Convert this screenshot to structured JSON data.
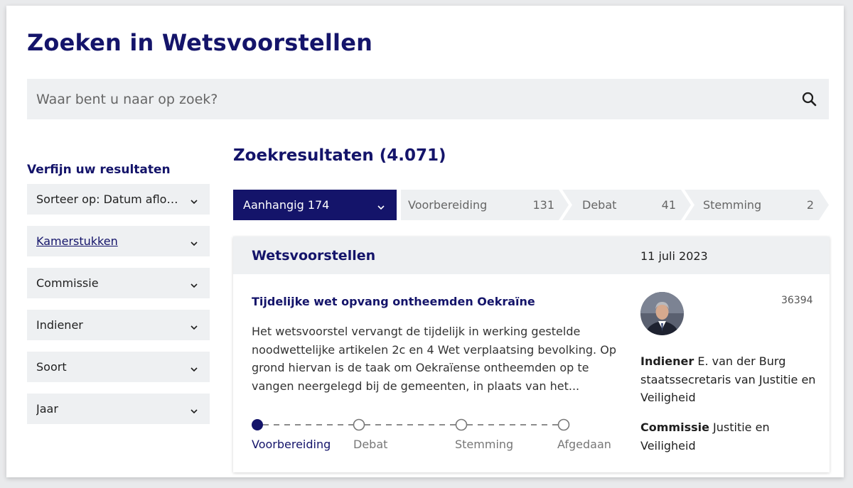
{
  "header": {
    "title": "Zoeken in Wetsvoorstellen"
  },
  "search": {
    "placeholder": "Waar bent u naar op zoek?",
    "value": ""
  },
  "sidebar": {
    "title": "Verfijn uw resultaten",
    "filters": [
      {
        "label": "Sorteer op: Datum aflop..."
      },
      {
        "label": "Kamerstukken"
      },
      {
        "label": "Commissie"
      },
      {
        "label": "Indiener"
      },
      {
        "label": "Soort"
      },
      {
        "label": "Jaar"
      }
    ]
  },
  "results": {
    "title": "Zoekresultaten (4.071)",
    "stages": [
      {
        "label": "Aanhangig 174",
        "count": ""
      },
      {
        "label": "Voorbereiding",
        "count": "131"
      },
      {
        "label": "Debat",
        "count": "41"
      },
      {
        "label": "Stemming",
        "count": "2"
      }
    ]
  },
  "card": {
    "type": "Wetsvoorstellen",
    "date": "11 juli 2023",
    "title": "Tijdelijke wet opvang ontheemden Oekraïne",
    "number": "36394",
    "description": "Het wetsvoorstel vervangt de tijdelijk in werking gestelde noodwettelijke artikelen 2c en 4 Wet verplaatsing bevolking. Op grond hiervan is de taak om Oekraïense ontheemden op te vangen neergelegd bij de gemeenten, in plaats van het...",
    "indiener_label": "Indiener",
    "indiener_value": "E. van der Burg staatssecretaris van Justitie en Veiligheid",
    "commissie_label": "Commissie",
    "commissie_value": "Justitie en Veiligheid",
    "progress": {
      "steps": [
        "Voorbereiding",
        "Debat",
        "Stemming",
        "Afgedaan"
      ],
      "current_index": 0
    }
  },
  "colors": {
    "brand": "#14146a",
    "panel": "#eef0f2",
    "muted": "#666666"
  },
  "icons": {
    "search": "search-icon",
    "chevron": "chevron-down-icon"
  }
}
